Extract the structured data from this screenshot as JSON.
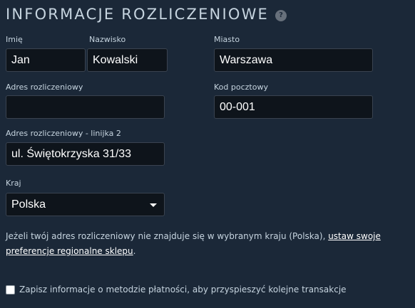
{
  "section": {
    "title": "INFORMACJE ROZLICZENIOWE",
    "help_glyph": "?"
  },
  "fields": {
    "first_name": {
      "label": "Imię",
      "value": "Jan"
    },
    "last_name": {
      "label": "Nazwisko",
      "value": "Kowalski"
    },
    "city": {
      "label": "Miasto",
      "value": "Warszawa"
    },
    "address": {
      "label": "Adres rozliczeniowy",
      "value": ""
    },
    "postal_code": {
      "label": "Kod pocztowy",
      "value": "00-001"
    },
    "address2": {
      "label": "Adres rozliczeniowy - linijka 2",
      "value": "ul. Świętokrzyska 31/33"
    },
    "country": {
      "label": "Kraj",
      "value": "Polska"
    }
  },
  "notice": {
    "text": "Jeżeli twój adres rozliczeniowy nie znajduje się w wybranym kraju (Polska), ",
    "link": "ustaw swoje preferencje regionalne sklepu",
    "suffix": "."
  },
  "save_payment": {
    "label": "Zapisz informacje o metodzie płatności, aby przyspieszyć kolejne transakcje",
    "checked": false
  },
  "colors": {
    "background": "#1b2838",
    "input_bg": "#0e141b",
    "text": "#c6d4df",
    "value_text": "#ffffff"
  },
  "icons": {
    "help": "question-circle-icon",
    "dropdown": "caret-down-icon"
  }
}
